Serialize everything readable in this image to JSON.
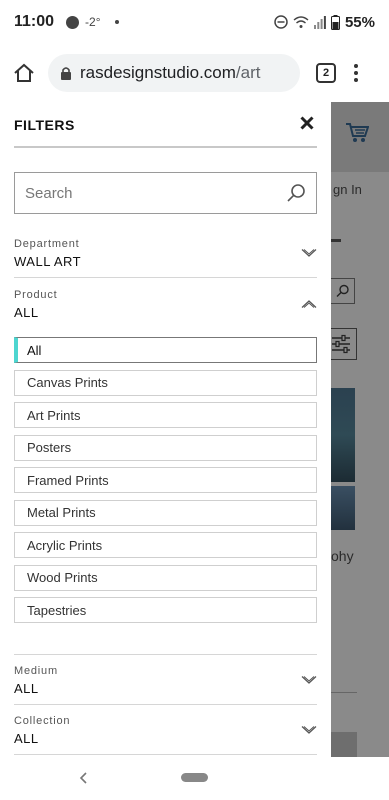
{
  "status_bar": {
    "time": "11:00",
    "temperature": "-2°",
    "battery": "55%"
  },
  "browser": {
    "domain": "rasdesignstudio.com",
    "path": "/art",
    "tab_count": "2"
  },
  "filters": {
    "title": "FILTERS",
    "search_placeholder": "Search",
    "department": {
      "label": "Department",
      "value": "WALL ART"
    },
    "product": {
      "label": "Product",
      "value": "ALL",
      "options": [
        "All",
        "Canvas Prints",
        "Art Prints",
        "Posters",
        "Framed Prints",
        "Metal Prints",
        "Acrylic Prints",
        "Wood Prints",
        "Tapestries"
      ],
      "selected": "All"
    },
    "medium": {
      "label": "Medium",
      "value": "ALL"
    },
    "collection": {
      "label": "Collection",
      "value": "ALL"
    }
  },
  "background_page": {
    "sign_in_fragment": "gn In",
    "text_fragment": "ohy"
  },
  "colors": {
    "accent": "#4dd6d0",
    "overlay": "#8a8a8a"
  }
}
